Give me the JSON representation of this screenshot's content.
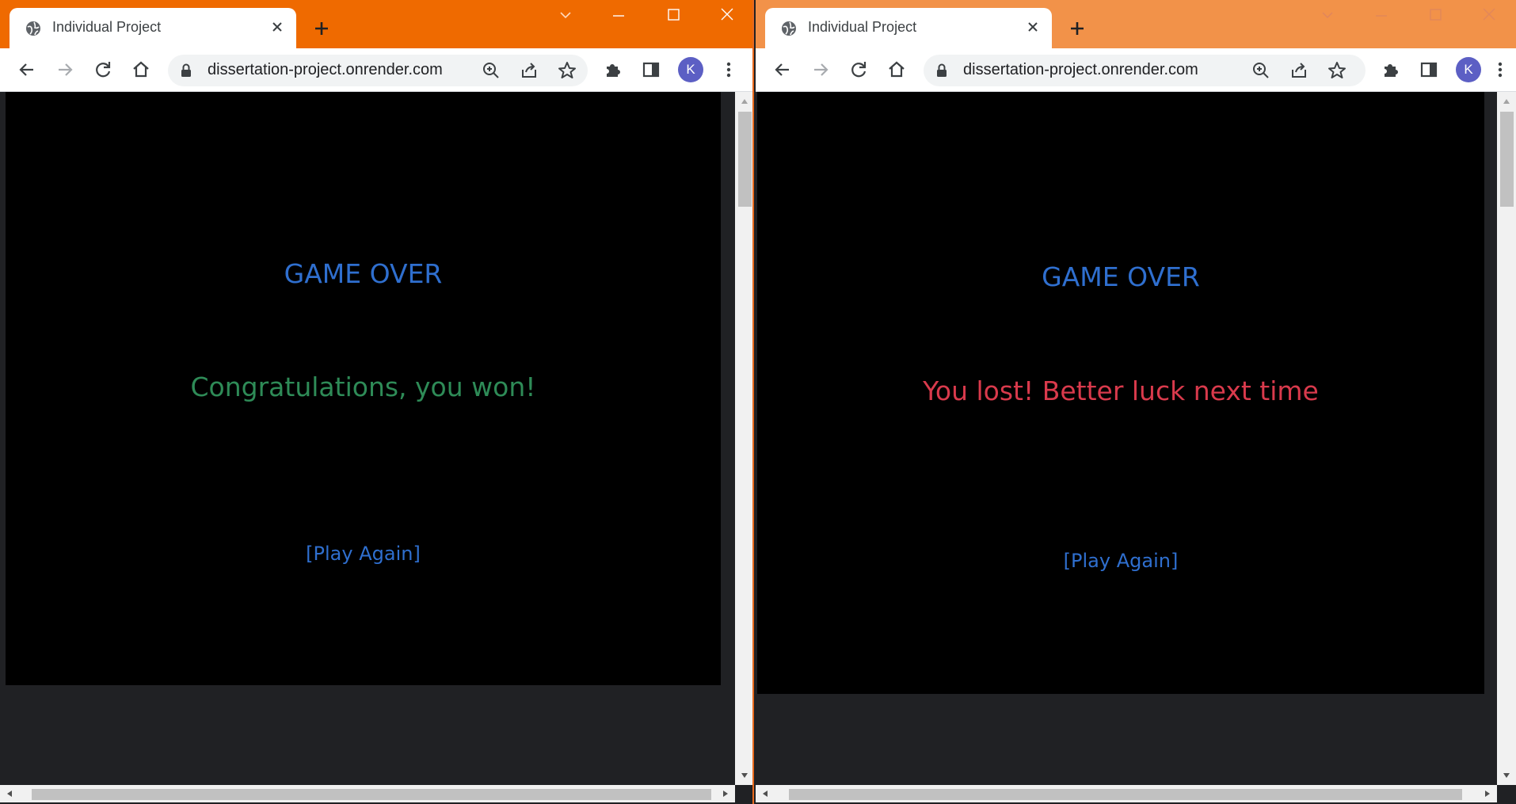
{
  "windows": {
    "left": {
      "tab_title": "Individual Project",
      "url": "dissertation-project.onrender.com",
      "avatar_initial": "K",
      "game": {
        "title": "GAME OVER",
        "message": "Congratulations, you won!",
        "message_color": "#2e8b57",
        "play_again": "[Play Again]"
      }
    },
    "right": {
      "tab_title": "Individual Project",
      "url": "dissertation-project.onrender.com",
      "avatar_initial": "K",
      "game": {
        "title": "GAME OVER",
        "message": "You lost! Better luck next time",
        "message_color": "#d93a4c",
        "play_again": "[Play Again]"
      }
    }
  },
  "colors": {
    "left_titlebar": "#ef6a00",
    "right_titlebar": "#f29249",
    "game_blue": "#2f6fcf",
    "page_bg": "#202124"
  }
}
